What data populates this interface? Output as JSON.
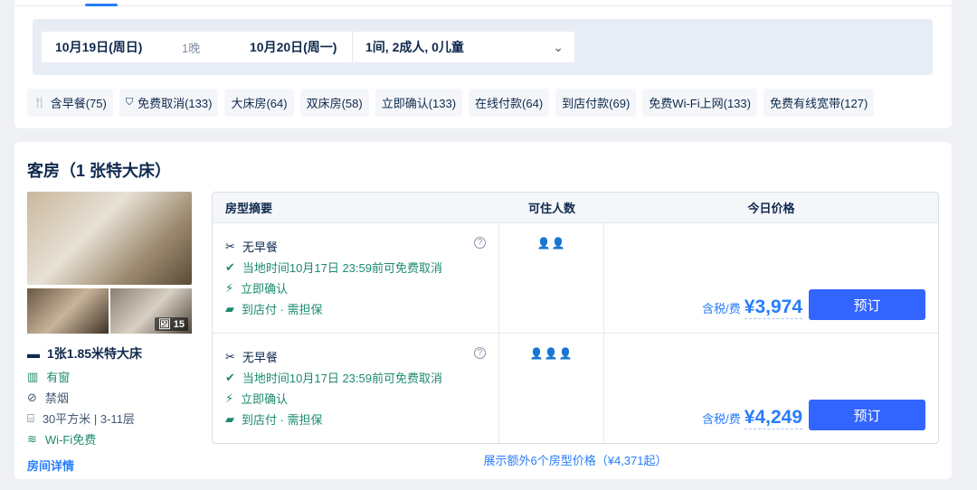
{
  "search": {
    "checkin": "10月19日(周日)",
    "nights": "1晚",
    "checkout": "10月20日(周一)",
    "guests": "1间, 2成人, 0儿童"
  },
  "filters": [
    {
      "label": "含早餐(75)",
      "icon": "utensils-icon"
    },
    {
      "label": "免费取消(133)",
      "icon": "shield-check-icon"
    },
    {
      "label": "大床房(64)"
    },
    {
      "label": "双床房(58)"
    },
    {
      "label": "立即确认(133)"
    },
    {
      "label": "在线付款(64)"
    },
    {
      "label": "到店付款(69)"
    },
    {
      "label": "免费Wi-Fi上网(133)"
    },
    {
      "label": "免费有线宽带(127)"
    }
  ],
  "room": {
    "title": "客房（1 张特大床）",
    "photo_count": "15",
    "bed": "1张1.85米特大床",
    "window": "有窗",
    "smoking": "禁烟",
    "size": "30平方米 | 3-11层",
    "wifi": "Wi-Fi免费",
    "details_link": "房间详情"
  },
  "table": {
    "headers": [
      "房型摘要",
      "可住人数",
      "今日价格"
    ],
    "rows": [
      {
        "meal": "无早餐",
        "cancel": "当地时间10月17日 23:59前可免费取消",
        "confirm": "立即确认",
        "pay": "到店付 · 需担保",
        "occupancy": 2,
        "price_label": "含税/费",
        "price": "¥3,974",
        "book": "预订"
      },
      {
        "meal": "无早餐",
        "cancel": "当地时间10月17日 23:59前可免费取消",
        "confirm": "立即确认",
        "pay": "到店付 · 需担保",
        "occupancy": 3,
        "price_label": "含税/费",
        "price": "¥4,249",
        "book": "预订"
      }
    ]
  },
  "more_link": "展示额外6个房型价格（¥4,371起）",
  "colors": {
    "accent": "#287dfa",
    "button": "#3264ff",
    "green": "#1c8a6f"
  }
}
